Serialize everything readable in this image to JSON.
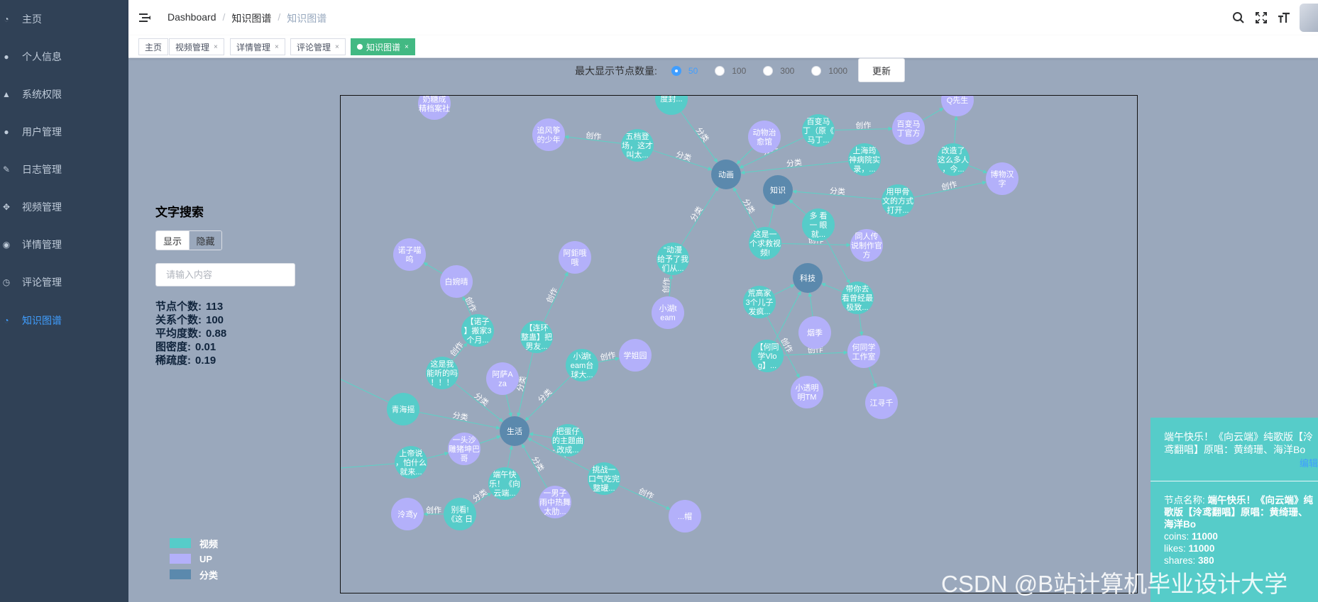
{
  "sidebar": {
    "items": [
      {
        "label": "主页",
        "icon": "dashboard-icon",
        "glyph": "◔"
      },
      {
        "label": "个人信息",
        "icon": "user-icon",
        "glyph": "●"
      },
      {
        "label": "系统权限",
        "icon": "permission-icon",
        "glyph": "▲"
      },
      {
        "label": "用户管理",
        "icon": "users-icon",
        "glyph": "●"
      },
      {
        "label": "日志管理",
        "icon": "pen-icon",
        "glyph": "✎"
      },
      {
        "label": "视频管理",
        "icon": "move-icon",
        "glyph": "✥"
      },
      {
        "label": "详情管理",
        "icon": "location-icon",
        "glyph": "◉"
      },
      {
        "label": "评论管理",
        "icon": "clock-icon",
        "glyph": "◷"
      },
      {
        "label": "知识图谱",
        "icon": "chart-icon",
        "glyph": "◔"
      }
    ],
    "active_index": 8
  },
  "navbar": {
    "breadcrumb": [
      "Dashboard",
      "知识图谱",
      "知识图谱"
    ]
  },
  "tags": [
    {
      "label": "主页",
      "closable": false
    },
    {
      "label": "视频管理",
      "closable": true
    },
    {
      "label": "详情管理",
      "closable": true
    },
    {
      "label": "评论管理",
      "closable": true
    },
    {
      "label": "知识图谱",
      "closable": true,
      "active": true
    }
  ],
  "controls": {
    "label": "最大显示节点数量:",
    "options": [
      "50",
      "100",
      "300",
      "1000"
    ],
    "selected": "50",
    "update_label": "更新"
  },
  "left_panel": {
    "title": "文字搜索",
    "show_label": "显示",
    "hide_label": "隐藏",
    "search_placeholder": "请输入内容",
    "stats": [
      {
        "label": "节点个数:",
        "value": "113"
      },
      {
        "label": "关系个数:",
        "value": "100"
      },
      {
        "label": "平均度数:",
        "value": "0.88"
      },
      {
        "label": "图密度:",
        "value": "0.01"
      },
      {
        "label": "稀疏度:",
        "value": "0.19"
      }
    ]
  },
  "legend": [
    {
      "label": "视频",
      "color": "#56ccc9"
    },
    {
      "label": "UP",
      "color": "#b3b0fa"
    },
    {
      "label": "分类",
      "color": "#5b89ad"
    }
  ],
  "colors": {
    "video": "#56ccc9",
    "up": "#b3b0fa",
    "category": "#5b89ad",
    "edge": "#5bd3c6",
    "accent": "#409eff",
    "tag_active": "#42b983"
  },
  "graph": {
    "nodes": [
      {
        "id": "donghua",
        "type": "category",
        "lines": [
          "动画"
        ]
      },
      {
        "id": "zhishi",
        "type": "category",
        "lines": [
          "知识"
        ]
      },
      {
        "id": "keji",
        "type": "category",
        "lines": [
          "科技"
        ]
      },
      {
        "id": "shenghuo",
        "type": "category",
        "lines": [
          "生活"
        ]
      },
      {
        "id": "n1",
        "type": "up",
        "lines": [
          "奶糖成",
          "精档案社"
        ]
      },
      {
        "id": "n2",
        "type": "video",
        "lines": [
          "度封..."
        ]
      },
      {
        "id": "n3",
        "type": "up",
        "lines": [
          "追风筝",
          "的少年"
        ]
      },
      {
        "id": "n4",
        "type": "video",
        "lines": [
          "五档登",
          "场，这才",
          "叫太..."
        ]
      },
      {
        "id": "n5",
        "type": "up",
        "lines": [
          "动物治",
          "愈馆"
        ]
      },
      {
        "id": "n6",
        "type": "video",
        "lines": [
          "百变马",
          "丁（原《",
          "马丁..."
        ]
      },
      {
        "id": "n7",
        "type": "up",
        "lines": [
          "百变马",
          "丁官方"
        ]
      },
      {
        "id": "n8",
        "type": "up",
        "lines": [
          "Q先生"
        ]
      },
      {
        "id": "n9",
        "type": "video",
        "lines": [
          "上海筠",
          "神病院实",
          "录，..."
        ]
      },
      {
        "id": "n10",
        "type": "video",
        "lines": [
          "改造了",
          "这么多人",
          "，今..."
        ]
      },
      {
        "id": "n11",
        "type": "up",
        "lines": [
          "博物汉",
          "字"
        ]
      },
      {
        "id": "n12",
        "type": "video",
        "lines": [
          "用甲骨",
          "文的方式",
          "打开..."
        ]
      },
      {
        "id": "n13",
        "type": "video",
        "lines": [
          "多 看",
          "一 眼",
          "就..."
        ]
      },
      {
        "id": "n14",
        "type": "video",
        "lines": [
          "这是一",
          "个求救视",
          "频!"
        ]
      },
      {
        "id": "n15",
        "type": "up",
        "lines": [
          "同人传",
          "说制作官",
          "方"
        ]
      },
      {
        "id": "n16",
        "type": "video",
        "lines": [
          "\"动漫",
          "给予了我",
          "们从..."
        ]
      },
      {
        "id": "n17",
        "type": "up",
        "lines": [
          "诺子喵",
          "呜"
        ]
      },
      {
        "id": "n18",
        "type": "up",
        "lines": [
          "阿鉅哦",
          "哦"
        ]
      },
      {
        "id": "n19",
        "type": "up",
        "lines": [
          "白婉晴"
        ]
      },
      {
        "id": "n20",
        "type": "video",
        "lines": [
          "【诺子",
          "】搬家3",
          "个月..."
        ]
      },
      {
        "id": "n21",
        "type": "video",
        "lines": [
          "【连环",
          "整蛊】把",
          "男友..."
        ]
      },
      {
        "id": "n22",
        "type": "up",
        "lines": [
          "小湖t",
          "eam"
        ]
      },
      {
        "id": "n23",
        "type": "video",
        "lines": [
          "荒高家",
          "3个儿子",
          "发疯..."
        ]
      },
      {
        "id": "n24",
        "type": "video",
        "lines": [
          "带你去",
          "看曾经最",
          "极致..."
        ]
      },
      {
        "id": "n25",
        "type": "up",
        "lines": [
          "烟季"
        ]
      },
      {
        "id": "n26",
        "type": "video",
        "lines": [
          "【何同",
          "学Vlo",
          "g】..."
        ]
      },
      {
        "id": "n27",
        "type": "up",
        "lines": [
          "何同学",
          "工作室"
        ]
      },
      {
        "id": "n28",
        "type": "up",
        "lines": [
          "小透明",
          "明TM"
        ]
      },
      {
        "id": "n29",
        "type": "up",
        "lines": [
          "江寻千"
        ]
      },
      {
        "id": "n30",
        "type": "video",
        "lines": [
          "这是我",
          "能听的吗",
          "！！！"
        ]
      },
      {
        "id": "n31",
        "type": "up",
        "lines": [
          "阿萨A",
          "za"
        ]
      },
      {
        "id": "n32",
        "type": "video",
        "lines": [
          "小湖t",
          "eam台",
          "球大..."
        ]
      },
      {
        "id": "n33",
        "type": "up",
        "lines": [
          "学姐园"
        ]
      },
      {
        "id": "n34",
        "type": "video",
        "lines": [
          "青海摇"
        ]
      },
      {
        "id": "n35",
        "type": "up",
        "lines": [
          "一头沙",
          "雕猪坤巴",
          "哥"
        ]
      },
      {
        "id": "n36",
        "type": "video",
        "lines": [
          "把蛋仔",
          "的主题曲",
          "改成..."
        ]
      },
      {
        "id": "n37",
        "type": "video",
        "lines": [
          "上帝说",
          "，怕什么",
          "就来..."
        ]
      },
      {
        "id": "n38",
        "type": "video",
        "lines": [
          "端午快",
          "乐！《向",
          "云端..."
        ]
      },
      {
        "id": "n39",
        "type": "video",
        "lines": [
          "挑战一",
          "口气吃完",
          "整罐..."
        ]
      },
      {
        "id": "n40",
        "type": "up",
        "lines": [
          "一男子",
          "雨中热舞",
          "太肋..."
        ]
      },
      {
        "id": "n41",
        "type": "up",
        "lines": [
          "泠鸢y"
        ]
      },
      {
        "id": "n42",
        "type": "video",
        "lines": [
          "别看!",
          "《这 日"
        ]
      },
      {
        "id": "n43",
        "type": "up",
        "lines": [
          "...帽"
        ]
      }
    ],
    "edges": [
      {
        "s": "n2",
        "t": "donghua",
        "label": "分类"
      },
      {
        "s": "n4",
        "t": "n3",
        "label": "创作"
      },
      {
        "s": "n4",
        "t": "donghua",
        "label": "分类"
      },
      {
        "s": "n5",
        "t": "donghua",
        "label": ""
      },
      {
        "s": "n6",
        "t": "donghua",
        "label": "分类"
      },
      {
        "s": "n6",
        "t": "n7",
        "label": "创作"
      },
      {
        "s": "n7",
        "t": "n8",
        "label": ""
      },
      {
        "s": "n9",
        "t": "donghua",
        "label": "分类"
      },
      {
        "s": "n10",
        "t": "n8",
        "label": ""
      },
      {
        "s": "n10",
        "t": "n11",
        "label": ""
      },
      {
        "s": "n12",
        "t": "zhishi",
        "label": "分类"
      },
      {
        "s": "n12",
        "t": "n11",
        "label": "创作"
      },
      {
        "s": "n13",
        "t": "zhishi",
        "label": ""
      },
      {
        "s": "n14",
        "t": "donghua",
        "label": "分类"
      },
      {
        "s": "n14",
        "t": "zhishi",
        "label": ""
      },
      {
        "s": "n14",
        "t": "n15",
        "label": "创作"
      },
      {
        "s": "n16",
        "t": "donghua",
        "label": "分类"
      },
      {
        "s": "n22",
        "t": "n16",
        "label": "创作"
      },
      {
        "s": "n13",
        "t": "n24",
        "label": ""
      },
      {
        "s": "n23",
        "t": "keji",
        "label": ""
      },
      {
        "s": "n24",
        "t": "keji",
        "label": ""
      },
      {
        "s": "n25",
        "t": "keji",
        "label": ""
      },
      {
        "s": "n26",
        "t": "keji",
        "label": ""
      },
      {
        "s": "n26",
        "t": "n27",
        "label": "创作"
      },
      {
        "s": "n23",
        "t": "n28",
        "label": "创作"
      },
      {
        "s": "n27",
        "t": "n29",
        "label": ""
      },
      {
        "s": "n24",
        "t": "n27",
        "label": ""
      },
      {
        "s": "n20",
        "t": "n19",
        "label": "创作"
      },
      {
        "s": "n19",
        "t": "n17",
        "label": ""
      },
      {
        "s": "n21",
        "t": "n18",
        "label": "创作"
      },
      {
        "s": "n30",
        "t": "n20",
        "label": "创作"
      },
      {
        "s": "n30",
        "t": "shenghuo",
        "label": "分类"
      },
      {
        "s": "n31",
        "t": "shenghuo",
        "label": ""
      },
      {
        "s": "n21",
        "t": "shenghuo",
        "label": "分类"
      },
      {
        "s": "n32",
        "t": "n33",
        "label": "创作"
      },
      {
        "s": "n32",
        "t": "shenghuo",
        "label": "分类"
      },
      {
        "s": "n34",
        "t": "shenghuo",
        "label": "分类"
      },
      {
        "s": "n36",
        "t": "shenghuo",
        "label": ""
      },
      {
        "s": "n35",
        "t": "shenghuo",
        "label": ""
      },
      {
        "s": "n37",
        "t": "n35",
        "label": ""
      },
      {
        "s": "n38",
        "t": "shenghuo",
        "label": ""
      },
      {
        "s": "n40",
        "t": "shenghuo",
        "label": "分类"
      },
      {
        "s": "n39",
        "t": "shenghuo",
        "label": "分类"
      },
      {
        "s": "n39",
        "t": "n43",
        "label": "创作"
      },
      {
        "s": "n42",
        "t": "n41",
        "label": "创作"
      },
      {
        "s": "n42",
        "t": "n38",
        "label": "分类"
      }
    ]
  },
  "info_panel": {
    "title": "端午快乐！《向云端》纯歌版【泠鸢翻唱】原唱：黄绮珊、海洋Bo",
    "edit_label": "编辑",
    "detail_name_label": "节点名称:",
    "detail_name": "端午快乐！《向云端》纯歌版【泠鸢翻唱】原唱：黄绮珊、海洋Bo",
    "fields": [
      {
        "label": "coins:",
        "value": "11000"
      },
      {
        "label": "likes:",
        "value": "11000"
      },
      {
        "label": "shares:",
        "value": "380"
      }
    ]
  },
  "watermark": "CSDN @B站计算机毕业设计大学"
}
